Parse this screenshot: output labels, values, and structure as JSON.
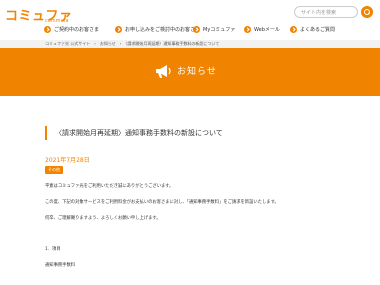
{
  "header": {
    "logo_text": "コミュファ",
    "logo_sub": "commufa",
    "search_placeholder": "サイト内を検索"
  },
  "nav": {
    "items": [
      {
        "label": "ご契約中のお客さま"
      },
      {
        "label": "お申し込みをご検討中のお客さま"
      },
      {
        "label": "Myコミュファ"
      },
      {
        "label": "Webメール"
      },
      {
        "label": "よくあるご質問"
      }
    ]
  },
  "breadcrumb": "コミュファ光 公式サイト　›　お知らせ　›　〈請求開始月再延期〉通知事務手数料の新設について",
  "hero": {
    "title": "お知らせ"
  },
  "article": {
    "title": "〈請求開始月再延期〉通知事務手数料の新設について",
    "date": "2021年7月28日",
    "badge": "その他",
    "paragraphs": [
      "平素はコミュファ光をご利用いただき誠にありがとうございます。",
      "この度、下記の対象サービスをご利用料金がお支払いのお客さまに対し、「通知事務手数料」をご請求を新設いたします。",
      "何卒、ご理解賜りますよう、よろしくお願い申し上げます。",
      "1．項目",
      "通知事務手数料"
    ]
  },
  "colors": {
    "accent": "#f08300",
    "breadcrumb_bg": "#f2f2f2"
  }
}
